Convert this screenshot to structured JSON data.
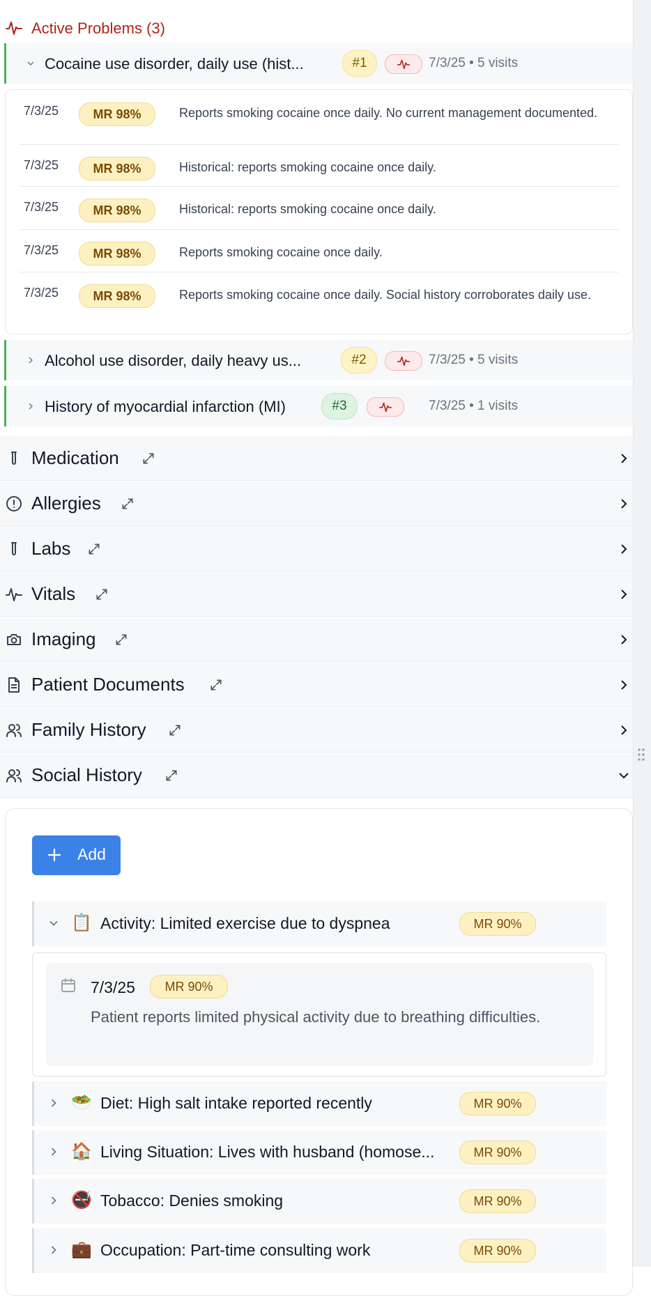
{
  "active_problems": {
    "title": "Active Problems (3)",
    "problems": [
      {
        "name": "Cocaine use disorder, daily use (hist...",
        "rank": "#1",
        "meta": "7/3/25 • 5 visits",
        "expanded": true
      },
      {
        "name": "Alcohol use disorder, daily heavy us...",
        "rank": "#2",
        "meta": "7/3/25 • 5 visits",
        "expanded": false
      },
      {
        "name": "History of myocardial infarction (MI)",
        "rank": "#3",
        "meta": "7/3/25 • 1 visits",
        "expanded": false
      }
    ],
    "visits": [
      {
        "date": "7/3/25",
        "badge": "MR 98%",
        "text": "Reports smoking cocaine once daily. No current management documented."
      },
      {
        "date": "7/3/25",
        "badge": "MR 98%",
        "text": "Historical: reports smoking cocaine once daily."
      },
      {
        "date": "7/3/25",
        "badge": "MR 98%",
        "text": "Historical: reports smoking cocaine once daily."
      },
      {
        "date": "7/3/25",
        "badge": "MR 98%",
        "text": "Reports smoking cocaine once daily."
      },
      {
        "date": "7/3/25",
        "badge": "MR 98%",
        "text": "Reports smoking cocaine once daily. Social history corroborates daily use."
      }
    ]
  },
  "sections": [
    {
      "label": "Medication",
      "icon": "test-tube-icon"
    },
    {
      "label": "Allergies",
      "icon": "alert-circle-icon"
    },
    {
      "label": "Labs",
      "icon": "test-tube-icon"
    },
    {
      "label": "Vitals",
      "icon": "pulse-icon"
    },
    {
      "label": "Imaging",
      "icon": "camera-icon"
    },
    {
      "label": "Patient Documents",
      "icon": "document-icon"
    },
    {
      "label": "Family History",
      "icon": "users-icon"
    },
    {
      "label": "Social History",
      "icon": "users-icon"
    }
  ],
  "social_history": {
    "add_label": "Add",
    "items": [
      {
        "emoji": "📋",
        "label": "Activity: Limited exercise due to dyspnea",
        "badge": "MR 90%",
        "expanded": true
      },
      {
        "emoji": "🥗",
        "label": "Diet: High salt intake reported recently",
        "badge": "MR 90%"
      },
      {
        "emoji": "🏠",
        "label": "Living Situation: Lives with husband (homose...",
        "badge": "MR 90%"
      },
      {
        "emoji": "🚭",
        "label": "Tobacco: Denies smoking",
        "badge": "MR 90%"
      },
      {
        "emoji": "💼",
        "label": "Occupation: Part-time consulting work",
        "badge": "MR 90%"
      }
    ],
    "detail": {
      "date": "7/3/25",
      "badge": "MR 90%",
      "note": "Patient reports limited physical activity due to breathing difficulties."
    }
  },
  "colors": {
    "accent_red": "#b42318",
    "primary_blue": "#3b82e6",
    "problem_border_green": "#4caf50"
  }
}
